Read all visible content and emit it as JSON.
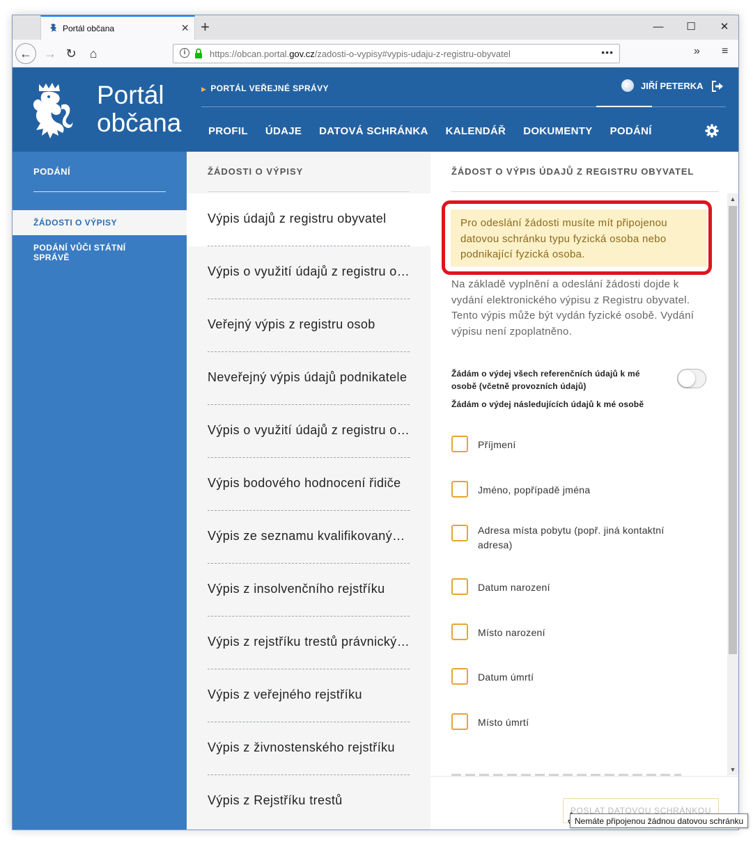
{
  "browser": {
    "tab_title": "Portál občana",
    "url_prefix": "https://obcan.portal.",
    "url_domain": "gov.cz",
    "url_suffix": "/zadosti-o-vypisy#vypis-udaju-z-registru-obyvatel",
    "icons": [
      "back-icon",
      "forward-icon",
      "reload-icon",
      "home-icon",
      "info-icon",
      "lock-icon",
      "more-icon",
      "overflow-icon",
      "menu-icon"
    ]
  },
  "header": {
    "brand_line1": "Portál",
    "brand_line2": "občana",
    "portal_link": "PORTÁL VEŘEJNÉ SPRÁVY",
    "user_name": "JIŘÍ PETERKA",
    "nav": [
      "PROFIL",
      "ÚDAJE",
      "DATOVÁ SCHRÁNKA",
      "KALENDÁŘ",
      "DOKUMENTY",
      "PODÁNÍ"
    ],
    "colors": {
      "header_bg": "#2362a2",
      "sidebar_bg": "#3a7cc1",
      "accent_orange": "#e8a530",
      "alert_red": "#e0141e"
    }
  },
  "sidebar": {
    "title": "PODÁNÍ",
    "items": [
      {
        "label": "ŽÁDOSTI O VÝPISY",
        "active": true
      },
      {
        "label": "PODÁNÍ VŮČI STÁTNÍ SPRÁVĚ",
        "active": false
      }
    ]
  },
  "list": {
    "title": "ŽÁDOSTI O VÝPISY",
    "items": [
      "Výpis údajů z registru obyvatel",
      "Výpis o využití údajů z registru obyvatel",
      "Veřejný výpis z registru osob",
      "Neveřejný výpis údajů podnikatele",
      "Výpis o využití údajů z registru osob",
      "Výpis bodového hodnocení řidiče",
      "Výpis ze seznamu kvalifikovaných dodavatelů",
      "Výpis z insolvenčního rejstříku",
      "Výpis z rejstříku trestů právnických osob",
      "Výpis z veřejného rejstříku",
      "Výpis z živnostenského rejstříku",
      "Výpis z Rejstříku trestů"
    ]
  },
  "detail": {
    "title": "ŽÁDOST O VÝPIS ÚDAJŮ Z REGISTRU OBYVATEL",
    "notice": "Pro odeslání žádosti musíte mít připojenou datovou schránku typu fyzická osoba nebo podnikající fyzická osoba.",
    "description": "Na základě vyplnění a odeslání žádosti dojde k vydání elektronického výpisu z Registru obyvatel. Tento výpis může být vydán fyzické osobě. Vydání výpisu není zpoplatněno.",
    "toggle_label": "Žádám o výdej všech referenčních údajů k mé osobě (včetně provozních údajů)",
    "toggle_on": false,
    "checkbox_heading": "Žádám o výdej následujících údajů k mé osobě",
    "checkboxes": [
      "Příjmení",
      "Jméno, popřípadě jména",
      "Adresa místa pobytu (popř. jiná kontaktní adresa)",
      "Datum narození",
      "Místo narození",
      "Datum úmrtí",
      "Místo úmrtí"
    ],
    "send_button": "POSLAT DATOVOU SCHRÁNKOU",
    "tooltip": "Nemáte připojenou žádnou datovou schránku"
  }
}
